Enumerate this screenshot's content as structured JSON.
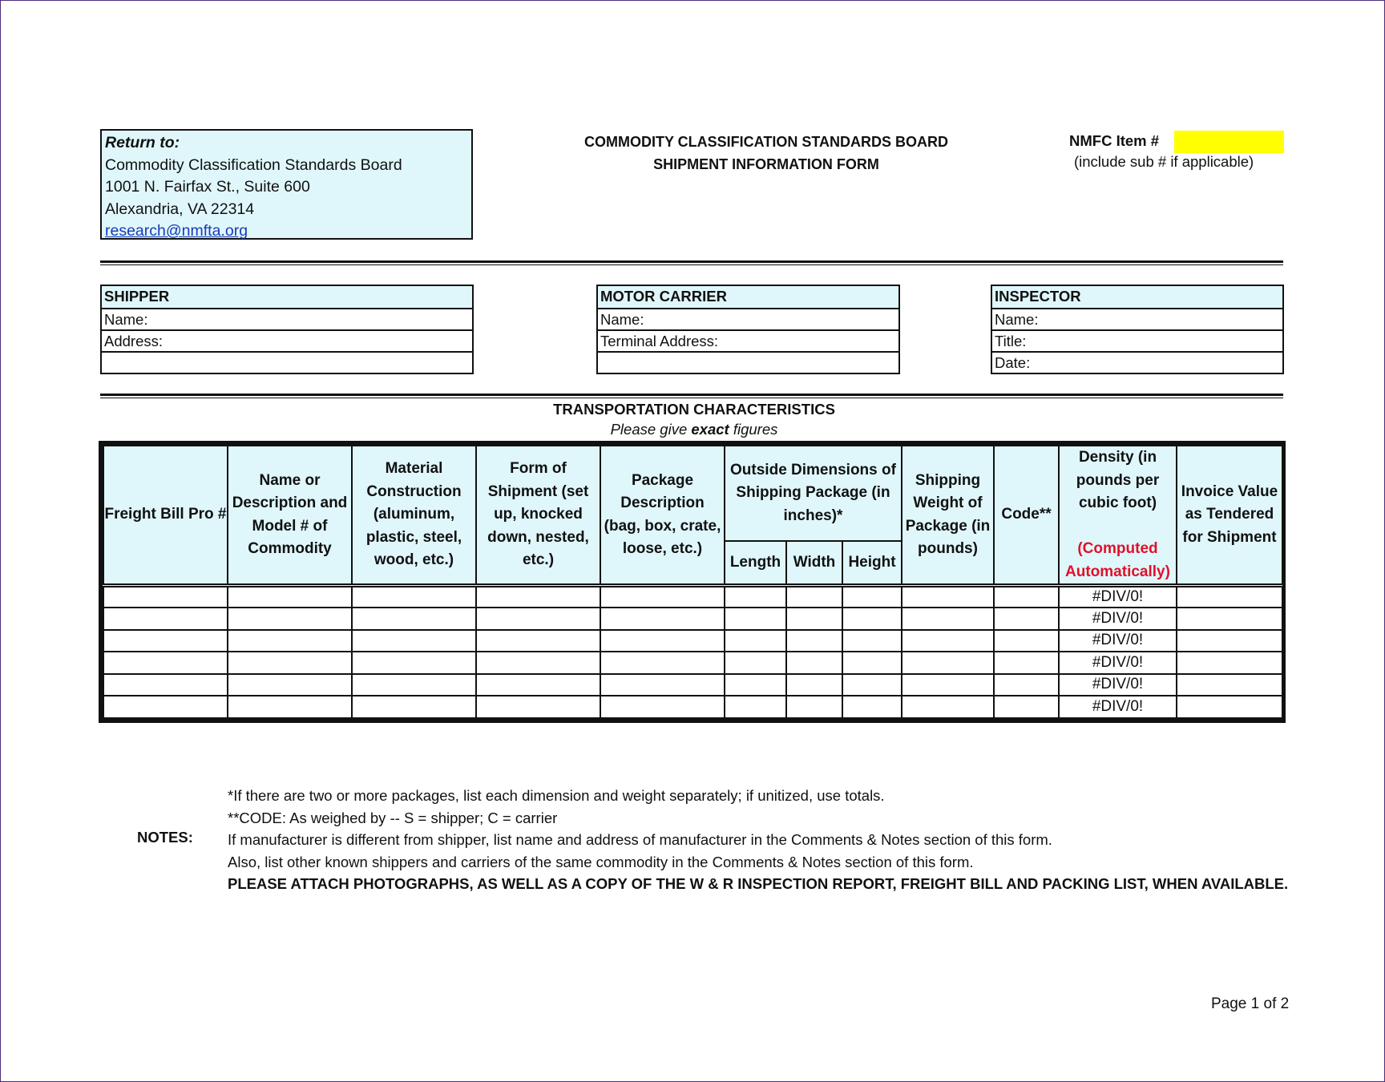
{
  "return_to": {
    "title": "Return to:",
    "org": "Commodity Classification Standards Board",
    "street": "1001 N. Fairfax St., Suite 600",
    "city": "Alexandria, VA 22314",
    "email": "research@nmfta.org"
  },
  "header": {
    "line1": "COMMODITY CLASSIFICATION STANDARDS BOARD",
    "line2": "SHIPMENT INFORMATION FORM"
  },
  "nmfc": {
    "label": "NMFC Item #",
    "value": "",
    "note": "(include sub # if applicable)",
    "highlight_color": "#ffff00"
  },
  "shipper": {
    "title": "SHIPPER",
    "rows": [
      "Name:",
      "Address:",
      ""
    ]
  },
  "motor_carrier": {
    "title": "MOTOR CARRIER",
    "rows": [
      "Name:",
      "Terminal Address:",
      ""
    ]
  },
  "inspector": {
    "title": "INSPECTOR",
    "rows": [
      "Name:",
      "Title:",
      "Date:"
    ]
  },
  "transportation": {
    "title": "TRANSPORTATION CHARACTERISTICS",
    "subtitle_pre": "Please give",
    "subtitle_bold": "exact",
    "subtitle_post": "figures"
  },
  "table": {
    "columns": [
      "Freight Bill Pro #",
      "Name or Description and Model # of Commodity",
      "Material Construction (aluminum, plastic, steel, wood, etc.)",
      "Form of Shipment (set up, knocked down, nested, etc.)",
      "Package Description (bag, box, crate, loose, etc.)",
      "Outside Dimensions of Shipping Package (in inches)*",
      "Shipping Weight of Package (in pounds)",
      "Code**",
      "Density (in pounds per cubic foot)",
      "Invoice Value as Tendered for Shipment"
    ],
    "density_note": "(Computed Automatically)",
    "dimension_subcolumns": [
      "Length",
      "Width",
      "Height"
    ],
    "rows": [
      {
        "density": "#DIV/0!"
      },
      {
        "density": "#DIV/0!"
      },
      {
        "density": "#DIV/0!"
      },
      {
        "density": "#DIV/0!"
      },
      {
        "density": "#DIV/0!"
      },
      {
        "density": "#DIV/0!"
      }
    ]
  },
  "notes": {
    "label": "NOTES:",
    "lines": [
      "*If there are two or more packages, list each dimension and weight separately; if unitized, use totals.",
      "**CODE:  As weighed by  --  S = shipper;  C = carrier",
      "If manufacturer is different from shipper, list name and address of manufacturer in the Comments & Notes section of this form.",
      "Also, list other known shippers and carriers of the same commodity in the Comments & Notes section of this form.",
      "PLEASE ATTACH PHOTOGRAPHS, AS WELL AS A COPY OF THE W & R INSPECTION REPORT, FREIGHT BILL AND PACKING LIST, WHEN AVAILABLE."
    ]
  },
  "footer": {
    "page": "Page 1 of 2"
  }
}
